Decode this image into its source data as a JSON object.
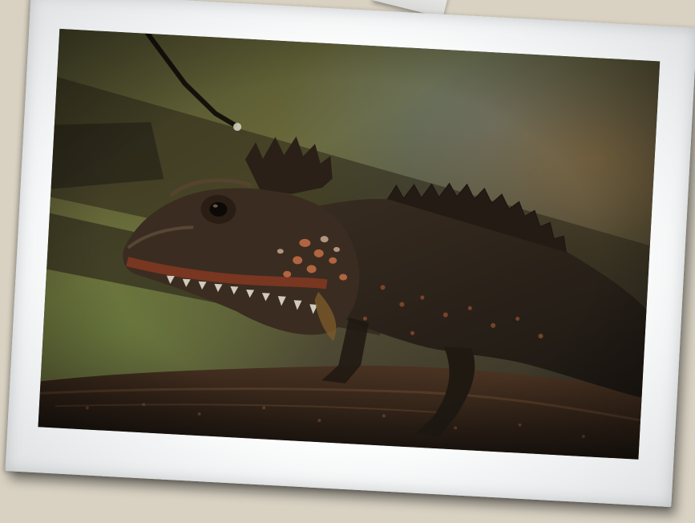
{
  "scene": {
    "background_color": "#d9d2c3",
    "frame_color": "#ffffff",
    "subject": "lizard",
    "colors": {
      "foliage_green": "#5e6e3c",
      "lizard_body": "#2c241c",
      "lizard_accent": "#b8603a",
      "branch_brown": "#3a2a1e"
    }
  }
}
